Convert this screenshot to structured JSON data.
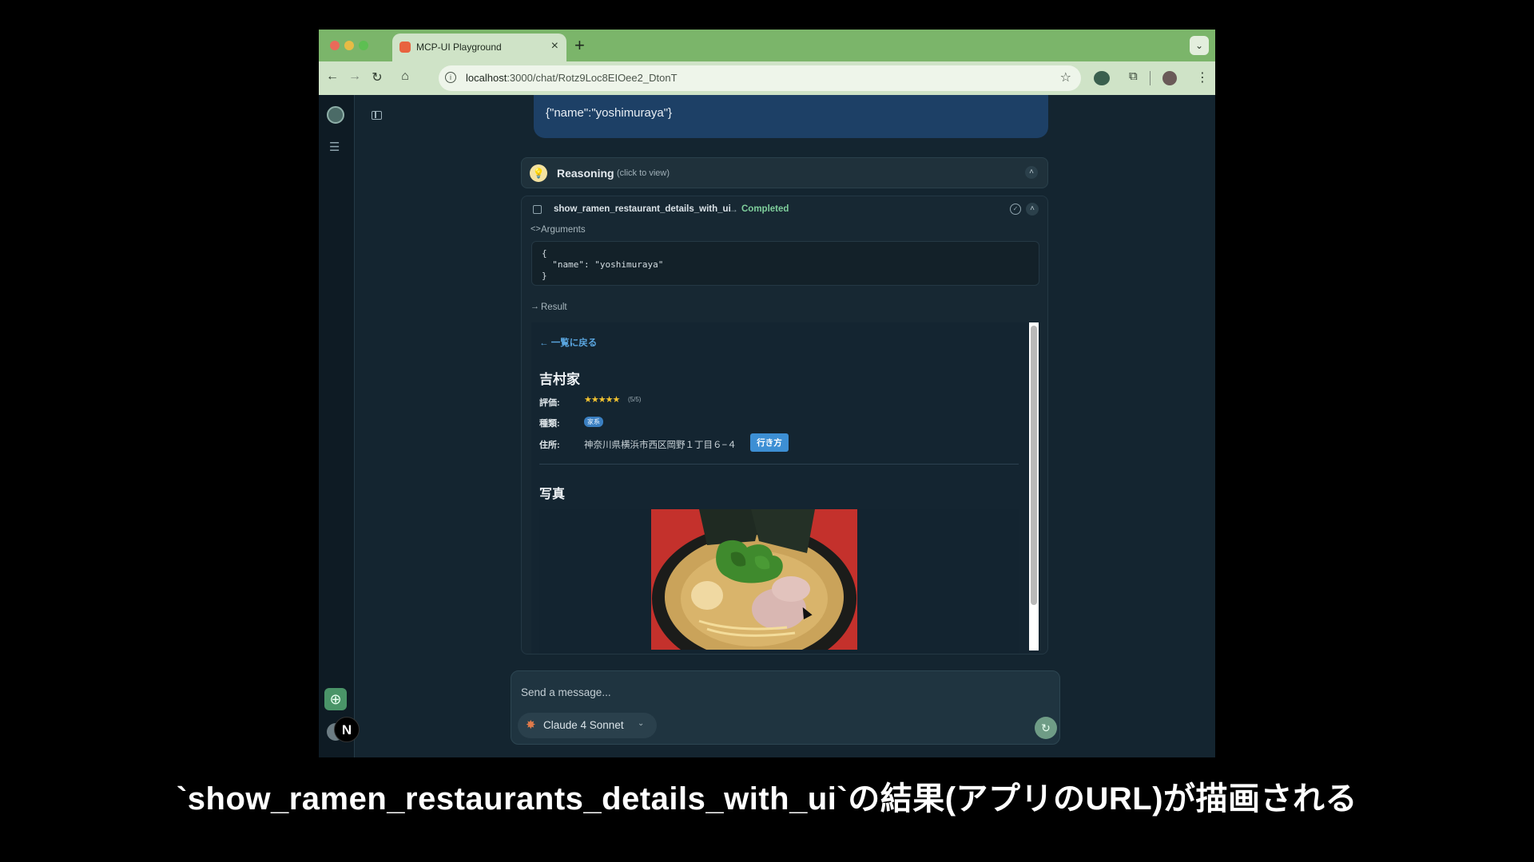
{
  "browser": {
    "tab_title": "MCP-UI Playground",
    "tab_close": "×",
    "new_tab": "+",
    "tab_menu": "⌄",
    "url_host": "localhost",
    "url_rest": ":3000/chat/Rotz9Loc8EIOee2_DtonT",
    "nav_back": "←",
    "nav_forward": "→",
    "nav_reload": "↻",
    "nav_home": "⌂",
    "star": "☆",
    "menu_dots": "⋮",
    "extensions": "⧉"
  },
  "sidebar": {
    "new_chat": "⊕",
    "stack_icon": "☰",
    "n_badge": "N"
  },
  "chat": {
    "user_message": "{\"name\":\"yoshimuraya\"}",
    "reasoning": {
      "label": "Reasoning",
      "hint": "(click to view)",
      "chevron": "˄"
    },
    "tool_call": {
      "name": "show_ramen_restaurant_details_with_ui",
      "arrow": "→",
      "status": "Completed",
      "check": "✓",
      "chevron": "˄",
      "args_glyph": "<>",
      "args_label": "Arguments",
      "code_lines": [
        "{",
        "  \"name\": \"yoshimuraya\"",
        "}"
      ],
      "result_glyph": "→",
      "result_label": "Result"
    },
    "result": {
      "back_link": "← 一覧に戻る",
      "restaurant_name": "吉村家",
      "rating_label": "評価:",
      "stars": "★★★★★",
      "rating_note": "(5/5)",
      "type_label": "種類:",
      "type_value": "家系",
      "address_label": "住所:",
      "address": "神奈川県横浜市西区岡野１丁目６−４",
      "directions_label": "行き方",
      "photo_heading": "写真"
    }
  },
  "composer": {
    "placeholder": "Send a message...",
    "model_spark": "✸",
    "model": "Claude 4 Sonnet",
    "model_chevron": "⌄",
    "send": "↻"
  },
  "caption": "`show_ramen_restaurants_details_with_ui`の結果(アプリのURL)が描画される",
  "colors": {
    "tab_bar": "#7bb56a",
    "app_bg": "#142530",
    "user_bubble": "#1d4066",
    "status_completed": "#7fcf9c",
    "link": "#5aa6e0",
    "directions_button": "#3d8fd4"
  }
}
